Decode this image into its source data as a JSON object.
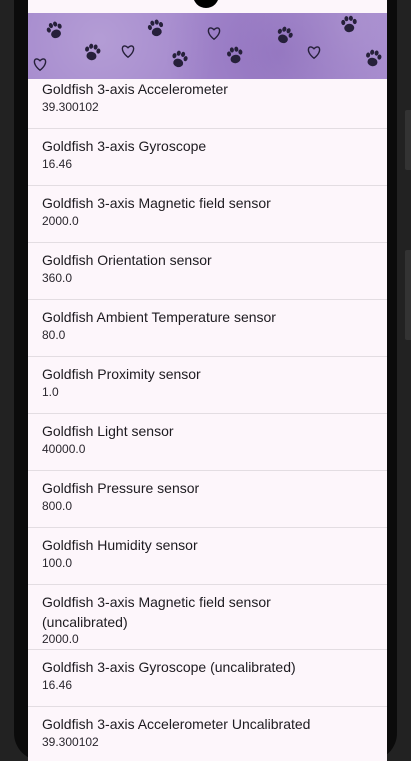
{
  "sensors": [
    {
      "name": "Goldfish 3-axis Accelerometer",
      "value": "39.300102"
    },
    {
      "name": "Goldfish 3-axis Gyroscope",
      "value": "16.46"
    },
    {
      "name": "Goldfish 3-axis Magnetic field sensor",
      "value": "2000.0"
    },
    {
      "name": "Goldfish Orientation sensor",
      "value": "360.0"
    },
    {
      "name": "Goldfish Ambient Temperature sensor",
      "value": "80.0"
    },
    {
      "name": "Goldfish Proximity sensor",
      "value": "1.0"
    },
    {
      "name": "Goldfish Light sensor",
      "value": "40000.0"
    },
    {
      "name": "Goldfish Pressure sensor",
      "value": "800.0"
    },
    {
      "name": "Goldfish Humidity sensor",
      "value": "100.0"
    },
    {
      "name": "Goldfish 3-axis Magnetic field sensor (uncalibrated)",
      "value": "2000.0"
    },
    {
      "name": "Goldfish 3-axis Gyroscope (uncalibrated)",
      "value": "16.46"
    },
    {
      "name": "Goldfish 3-axis Accelerometer Uncalibrated",
      "value": "39.300102"
    }
  ],
  "banner": {
    "background_color": "#a387cc",
    "icon_color": "#26203a",
    "icons": [
      "heart-outline-icon",
      "paw-print-icon"
    ]
  },
  "colors": {
    "screen_background": "#fdf6fb",
    "divider": "#e3dde2",
    "text_primary": "#1d1b20"
  }
}
